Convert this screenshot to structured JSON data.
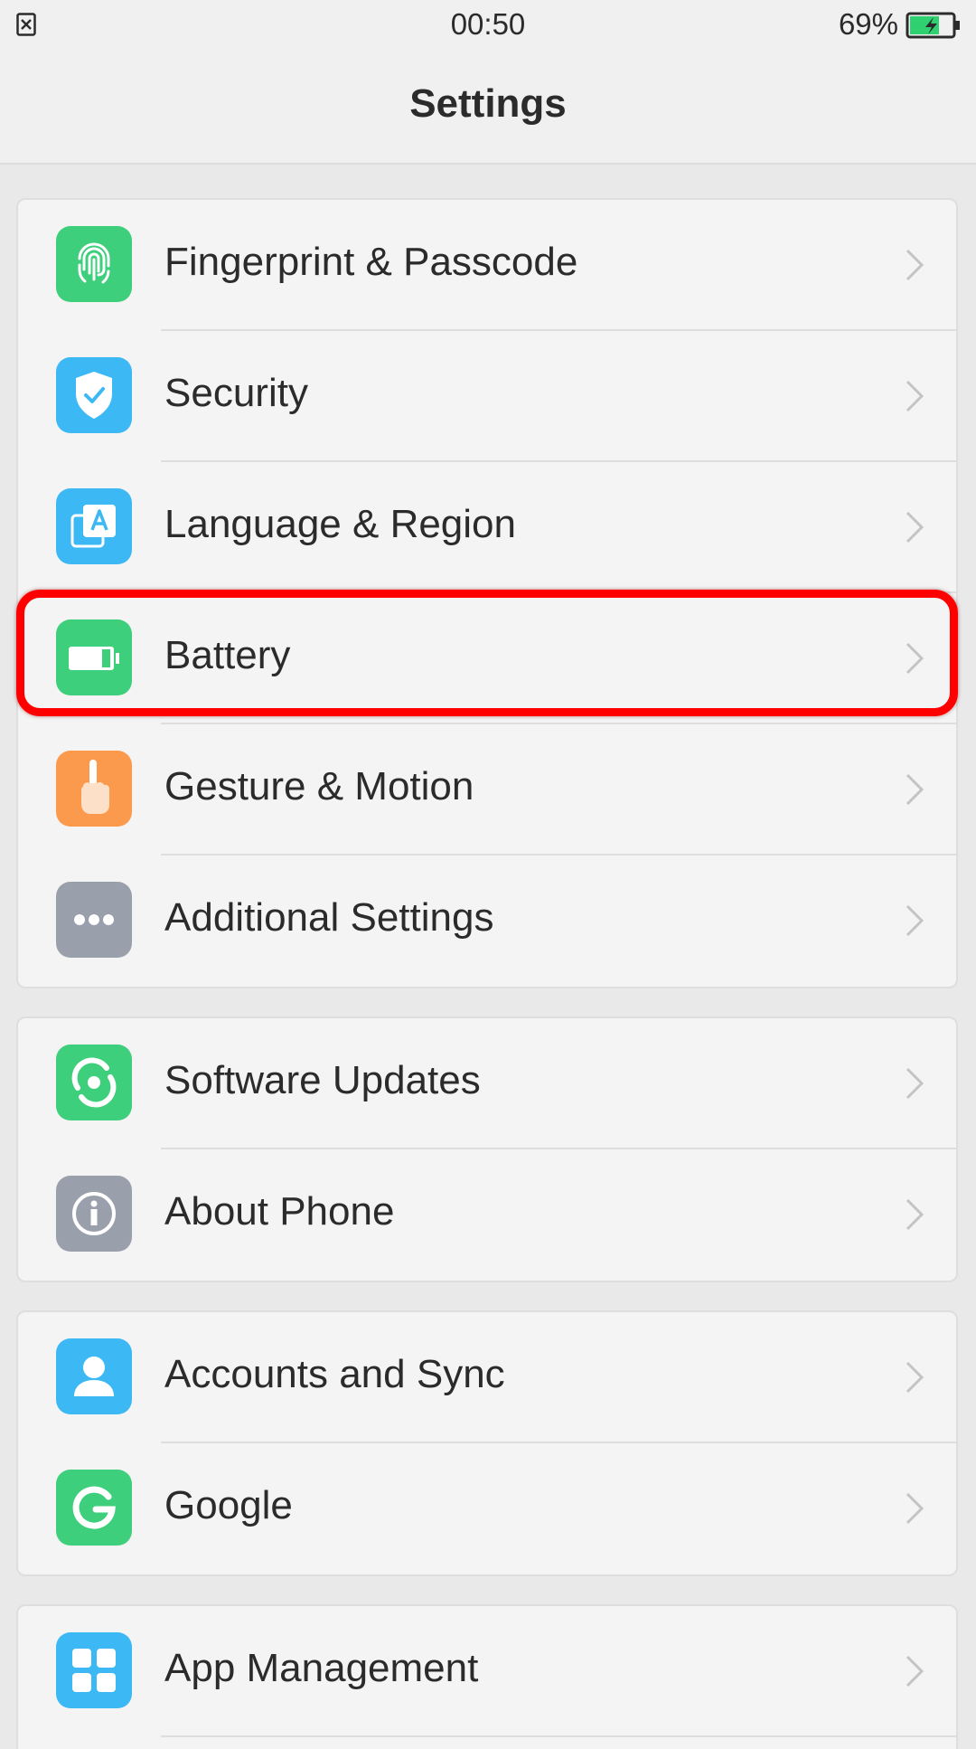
{
  "status_bar": {
    "left_icon": "sim-error-icon",
    "time": "00:50",
    "battery_percent": "69%",
    "battery_icon": "battery-charging-icon",
    "battery_level": 0.69
  },
  "header": {
    "title": "Settings"
  },
  "groups": [
    {
      "items": [
        {
          "label": "Fingerprint & Passcode",
          "icon": "fingerprint-icon",
          "color": "#3ecf7c"
        },
        {
          "label": "Security",
          "icon": "shield-check-icon",
          "color": "#3cb8f4"
        },
        {
          "label": "Language & Region",
          "icon": "language-icon",
          "color": "#3cb8f4"
        },
        {
          "label": "Battery",
          "icon": "battery-icon",
          "color": "#3ecf7c"
        },
        {
          "label": "Gesture & Motion",
          "icon": "hand-pointer-icon",
          "color": "#fb9a4c"
        },
        {
          "label": "Additional Settings",
          "icon": "more-dots-icon",
          "color": "#9aa0ab"
        }
      ]
    },
    {
      "items": [
        {
          "label": "Software Updates",
          "icon": "update-icon",
          "color": "#3ecf7c"
        },
        {
          "label": "About Phone",
          "icon": "info-icon",
          "color": "#9aa0ab"
        }
      ]
    },
    {
      "items": [
        {
          "label": "Accounts and Sync",
          "icon": "account-icon",
          "color": "#3cb8f4"
        },
        {
          "label": "Google",
          "icon": "google-icon",
          "color": "#3ecf7c"
        }
      ]
    },
    {
      "items": [
        {
          "label": "App Management",
          "icon": "apps-grid-icon",
          "color": "#3cb8f4"
        }
      ]
    }
  ],
  "highlight": {
    "target": "Battery",
    "color": "#ff0000"
  }
}
